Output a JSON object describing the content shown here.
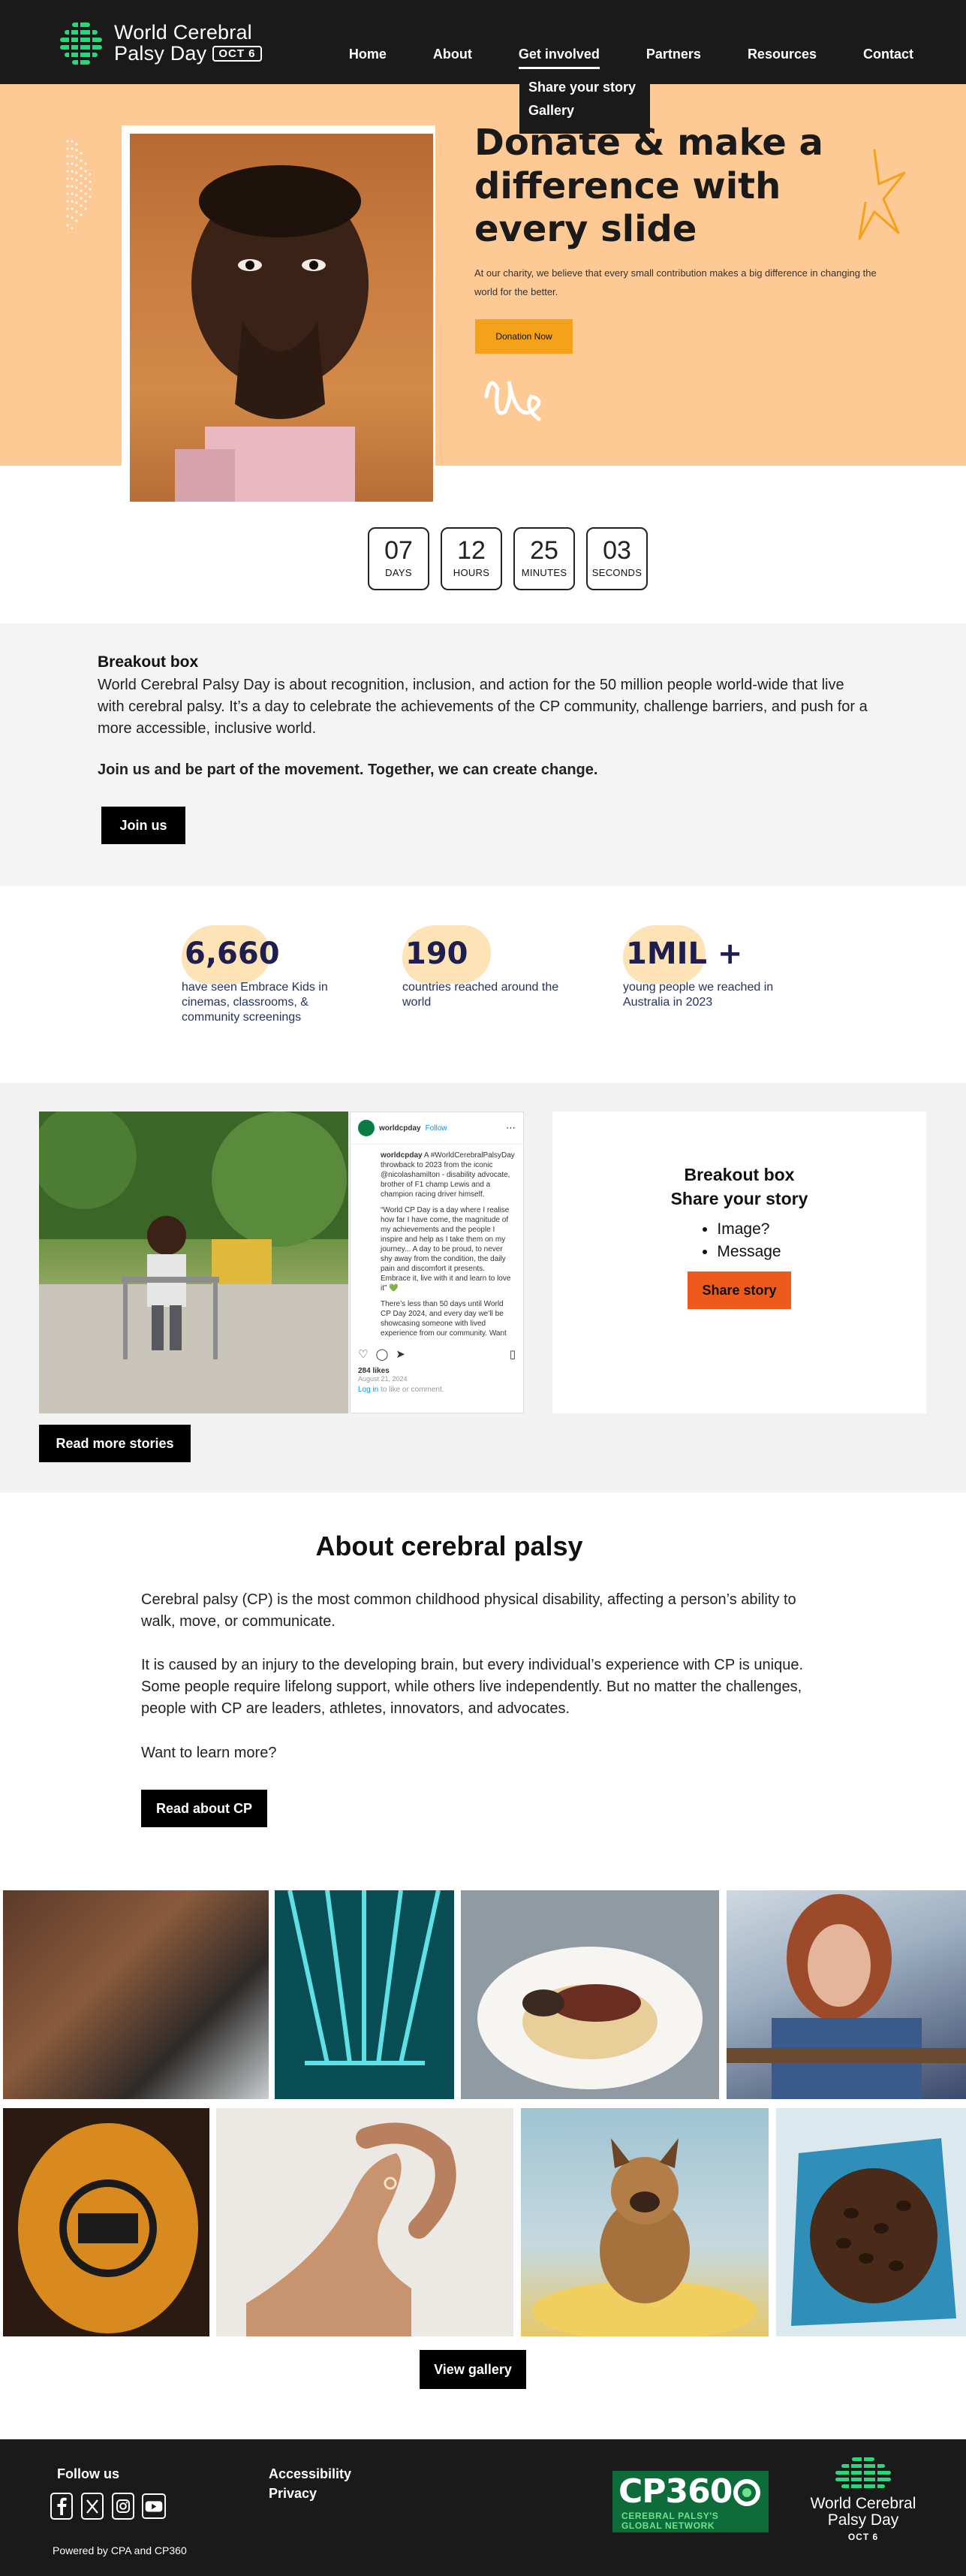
{
  "header": {
    "logo_line1": "World Cerebral",
    "logo_line2": "Palsy Day",
    "logo_badge": "OCT 6",
    "nav": [
      "Home",
      "About",
      "Get involved",
      "Partners",
      "Resources",
      "Contact"
    ],
    "active_nav": "Get involved",
    "dropdown": [
      "Share your story",
      "Gallery"
    ]
  },
  "hero": {
    "title": "Donate & make a difference with every slide",
    "text": "At our charity, we believe that every small contribution makes a big difference in changing the world for the better.",
    "button": "Donation Now"
  },
  "countdown": [
    {
      "value": "07",
      "label": "DAYS"
    },
    {
      "value": "12",
      "label": "HOURS"
    },
    {
      "value": "25",
      "label": "MINUTES"
    },
    {
      "value": "03",
      "label": "SECONDS"
    }
  ],
  "breakout": {
    "title": "Breakout box",
    "text": "World Cerebral Palsy Day is about recognition, inclusion, and action for the 50 million people world-wide that live with cerebral palsy. It’s a day to celebrate the achievements of the CP community, challenge barriers, and push for a more accessible, inclusive world.",
    "bold": "Join us and be part of the movement. Together, we can create change.",
    "button": "Join us"
  },
  "stats": [
    {
      "number": "6,660",
      "text": "have seen Embrace Kids in cinemas, classrooms,  & community screenings"
    },
    {
      "number": "190",
      "text": "countries reached around the world"
    },
    {
      "number": "1MIL +",
      "text": "young people we reached in Australia in 2023"
    }
  ],
  "instagram": {
    "account": "worldcpday",
    "follow": "Follow",
    "caption_user": "worldcpday",
    "caption": "A #WorldCerebralPalsyDay throwback to 2023 from the iconic @nicolashamilton - disability advocate, brother of F1 champ Lewis and a champion racing driver himself.",
    "quote": "“World CP Day is a day where I realise how far I have come, the magnitude of my achievements and the people I inspire and help as I take them on my journey... A day to be proud, to never shy away from the condition, the daily pain and discomfort it presents. Embrace it, live with it and learn to love it” 💚",
    "more": "There’s less than 50 days until World CP Day 2024, and every day we’ll be showcasing someone with lived experience from our community. Want",
    "likes": "284 likes",
    "date": "August 21, 2024",
    "login_link": "Log in",
    "login_text": " to like or comment."
  },
  "story_box": {
    "title": "Breakout box",
    "subtitle": "Share your story",
    "items": [
      "Image?",
      "Message"
    ],
    "button": "Share story"
  },
  "stories_button": "Read more stories",
  "about": {
    "title": "About cerebral palsy",
    "p1": "Cerebral palsy (CP) is the most common childhood physical disability, affecting a person’s ability to walk, move, or communicate.",
    "p2": "It is caused by an injury to the developing brain, but every individual’s experience with CP is unique. Some people require lifelong support, while others live independently. But no matter the challenges, people with CP are leaders, athletes, innovators, and advocates.",
    "p3": "Want to learn more?",
    "button": "Read about CP"
  },
  "gallery_button": "View gallery",
  "footer": {
    "follow": "Follow us",
    "social_icons": [
      "facebook-icon",
      "x-icon",
      "instagram-icon",
      "youtube-icon"
    ],
    "links": [
      "Accessibility",
      "Privacy"
    ],
    "powered": "Powered by CPA and CP360",
    "cp360": "CP360",
    "cp360_sub1": "CEREBRAL PALSY'S",
    "cp360_sub2": "GLOBAL NETWORK",
    "logo_line1": "World Cerebral",
    "logo_line2": "Palsy Day",
    "logo_badge": "OCT 6"
  },
  "colors": {
    "header_bg": "#1a1a1a",
    "hero_bg": "#fdc995",
    "donate_button": "#f5a21b",
    "share_button": "#ee5a1c",
    "stat_number": "#1f1f4f",
    "brand_green": "#0e6b3a"
  }
}
